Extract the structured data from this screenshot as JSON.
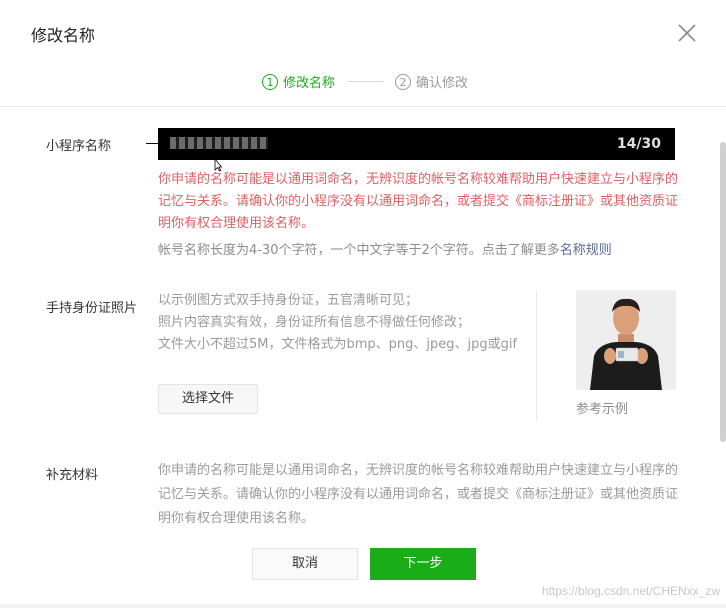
{
  "dialog": {
    "title": "修改名称"
  },
  "steps": [
    {
      "num": "1",
      "label": "修改名称",
      "active": true
    },
    {
      "num": "2",
      "label": "确认修改",
      "active": false
    }
  ],
  "name_field": {
    "label": "小程序名称",
    "counter": "14/30",
    "error": "你申请的名称可能是以通用词命名，无辨识度的帐号名称较难帮助用户快速建立与小程序的记忆与关系。请确认你的小程序没有以通用词命名，或者提交《商标注册证》或其他资质证明你有权合理使用该名称。",
    "hint_text": "帐号名称长度为4-30个字符，一个中文字等于2个字符。点击了解更多",
    "hint_link": "名称规则"
  },
  "id_photo": {
    "label": "手持身份证照片",
    "line1": "以示例图方式双手持身份证，五官清晰可见；",
    "line2": "照片内容真实有效，身份证所有信息不得做任何修改；",
    "line3": "文件大小不超过5M，文件格式为bmp、png、jpeg、jpg或gif",
    "button": "选择文件",
    "example_caption": "参考示例"
  },
  "supplement": {
    "label": "补充材料",
    "text": "你申请的名称可能是以通用词命名，无辨识度的帐号名称较难帮助用户快速建立与小程序的记忆与关系。请确认你的小程序没有以通用词命名，或者提交《商标注册证》或其他资质证明你有权合理使用该名称。"
  },
  "footer": {
    "cancel": "取消",
    "next": "下一步"
  },
  "watermark": "https://blog.csdn.net/CHENxx_zw",
  "colors": {
    "accent": "#1aad19",
    "error": "#e15f63",
    "link": "#576b95"
  }
}
